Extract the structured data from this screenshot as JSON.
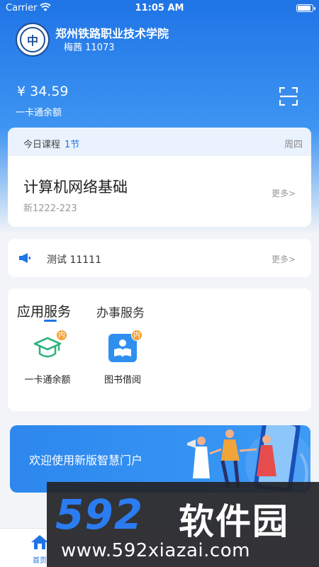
{
  "status_bar": {
    "carrier": "Carrier",
    "time": "11:05 AM",
    "battery_level": 0.95
  },
  "header": {
    "logo_glyph": "中",
    "school_name": "郑州铁路职业技术学院",
    "user": "梅茜 11073",
    "balance": "¥ 34.59",
    "balance_label": "一卡通余额",
    "scan_icon": "scan-icon"
  },
  "course": {
    "today_label": "今日课程",
    "count": "1节",
    "weekday": "周四",
    "title": "计算机网络基础",
    "room": "新1222-223",
    "more": "更多>"
  },
  "notice": {
    "icon": "megaphone-icon",
    "text": "测试 11111",
    "more": "更多>"
  },
  "services": {
    "tabs": [
      "应用服务",
      "办事服务"
    ],
    "items": [
      {
        "label": "一卡通余额",
        "badge": "内",
        "icon": "graduation-cap-icon"
      },
      {
        "label": "图书借阅",
        "badge": "内",
        "icon": "book-reader-icon"
      }
    ]
  },
  "banner": {
    "text": "欢迎使用新版智慧门户"
  },
  "tabbar": {
    "home_label": "首页"
  },
  "watermark": {
    "logo_digits": "592",
    "logo_cn": "软件园",
    "url": "www.592xiazai.com"
  },
  "colors": {
    "primary": "#1f74e6",
    "badge": "#f2a33a",
    "icon_green": "#2fb37a",
    "background": "#f2f4f7"
  }
}
